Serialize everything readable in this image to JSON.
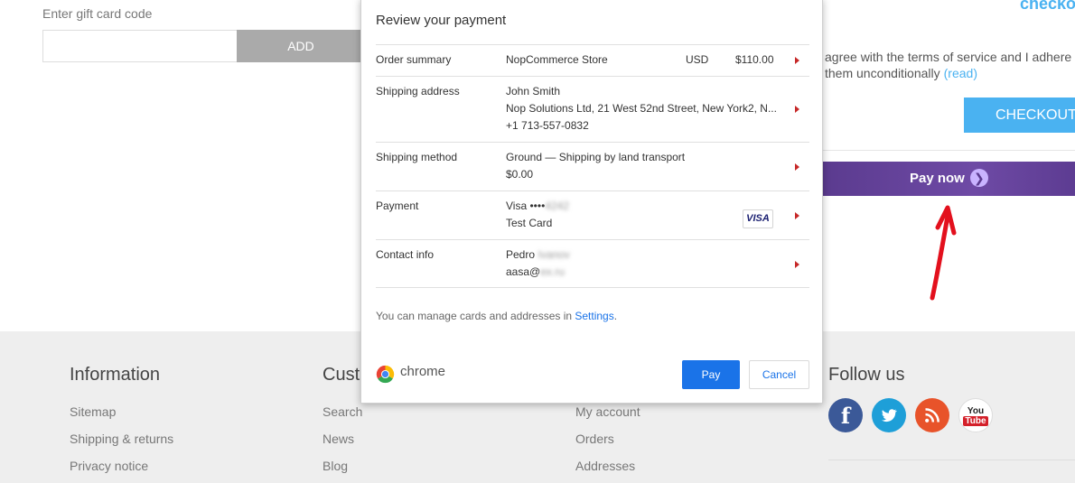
{
  "gift_card": {
    "label": "Enter gift card code",
    "input_value": "",
    "add_label": "ADD"
  },
  "checkout": {
    "heading": "checko",
    "terms_line1": "agree with the terms of service and I adhere",
    "terms_line2": "them unconditionally",
    "terms_link": "(read)",
    "checkout_button": "CHECKOUT",
    "pay_now": "Pay now",
    "accent_color": "#4ab2f1",
    "pay_now_color": "#5b3b8f"
  },
  "dialog": {
    "title": "Review your payment",
    "order_summary": {
      "label": "Order summary",
      "merchant": "NopCommerce Store",
      "currency": "USD",
      "amount": "$110.00"
    },
    "shipping_address": {
      "label": "Shipping address",
      "name": "John Smith",
      "address": "Nop Solutions Ltd, 21 West 52nd Street, New York2, N...",
      "phone": "+1 713-557-0832"
    },
    "shipping_method": {
      "label": "Shipping method",
      "method": "Ground — Shipping by land transport",
      "price": "$0.00"
    },
    "payment": {
      "label": "Payment",
      "card": "Visa  ••••",
      "card_masked_tail": "4242",
      "card_name": "Test Card",
      "badge": "VISA"
    },
    "contact_info": {
      "label": "Contact info",
      "name": "Pedro",
      "name_blurred": "Ivanov",
      "email": "aasa@",
      "email_blurred": "ex.ru"
    },
    "note_prefix": "You can manage cards and addresses in ",
    "note_link": "Settings",
    "note_suffix": ".",
    "brand": "chrome",
    "pay_label": "Pay",
    "cancel_label": "Cancel",
    "primary_color": "#1a73e8"
  },
  "footer": {
    "information": {
      "title": "Information",
      "links": [
        "Sitemap",
        "Shipping & returns",
        "Privacy notice"
      ]
    },
    "customer": {
      "title": "Custo",
      "links": [
        "Search",
        "News",
        "Blog"
      ]
    },
    "account": {
      "links": [
        "My account",
        "Orders",
        "Addresses"
      ]
    },
    "follow": {
      "title": "Follow us",
      "youtube_line1": "You",
      "youtube_line2": "Tube"
    }
  },
  "icons": [
    "facebook-icon",
    "twitter-icon",
    "rss-icon",
    "youtube-icon",
    "chrome-logo-icon",
    "chevron-right-icon",
    "visa-icon",
    "red-arrow-annotation"
  ]
}
